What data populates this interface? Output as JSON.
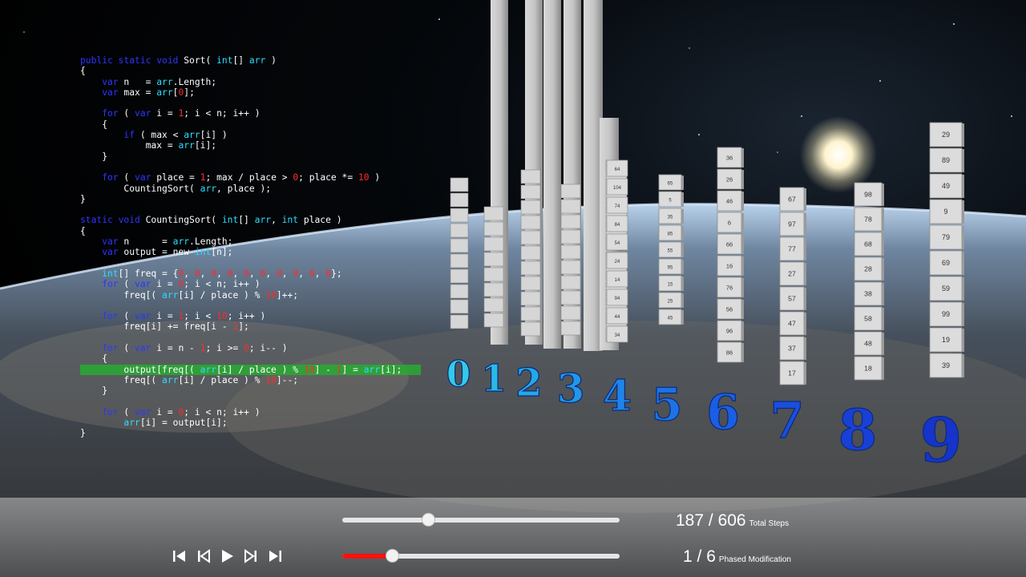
{
  "code_lines": [
    [
      [
        "kw",
        "public static void "
      ],
      [
        "t",
        "Sort( "
      ],
      [
        "ty",
        "int"
      ],
      [
        "t",
        "[] "
      ],
      [
        "ty",
        "arr"
      ],
      [
        "t",
        " )"
      ]
    ],
    [
      [
        "t",
        "{"
      ]
    ],
    [
      [
        "kw",
        "    var "
      ],
      [
        "t",
        "n   = "
      ],
      [
        "ty",
        "arr"
      ],
      [
        "t",
        ".Length;"
      ]
    ],
    [
      [
        "kw",
        "    var "
      ],
      [
        "t",
        "max = "
      ],
      [
        "ty",
        "arr"
      ],
      [
        "t",
        "["
      ],
      [
        "nu",
        "0"
      ],
      [
        "t",
        "];"
      ]
    ],
    [],
    [
      [
        "kw",
        "    for "
      ],
      [
        "t",
        "( "
      ],
      [
        "kw",
        "var "
      ],
      [
        "t",
        "i = "
      ],
      [
        "nu",
        "1"
      ],
      [
        "t",
        "; i < n; i++ )"
      ]
    ],
    [
      [
        "t",
        "    {"
      ]
    ],
    [
      [
        "kw",
        "        if "
      ],
      [
        "t",
        "( max < "
      ],
      [
        "ty",
        "arr"
      ],
      [
        "t",
        "[i] )"
      ]
    ],
    [
      [
        "t",
        "            max = "
      ],
      [
        "ty",
        "arr"
      ],
      [
        "t",
        "[i];"
      ]
    ],
    [
      [
        "t",
        "    }"
      ]
    ],
    [],
    [
      [
        "kw",
        "    for "
      ],
      [
        "t",
        "( "
      ],
      [
        "kw",
        "var "
      ],
      [
        "t",
        "place = "
      ],
      [
        "nu",
        "1"
      ],
      [
        "t",
        "; max / place > "
      ],
      [
        "nu",
        "0"
      ],
      [
        "t",
        "; place *= "
      ],
      [
        "nu",
        "10"
      ],
      [
        "t",
        " )"
      ]
    ],
    [
      [
        "t",
        "        CountingSort( "
      ],
      [
        "ty",
        "arr"
      ],
      [
        "t",
        ", place );"
      ]
    ],
    [
      [
        "t",
        "}"
      ]
    ],
    [],
    [
      [
        "kw",
        "static void "
      ],
      [
        "t",
        "CountingSort( "
      ],
      [
        "ty",
        "int"
      ],
      [
        "t",
        "[] "
      ],
      [
        "ty",
        "arr"
      ],
      [
        "t",
        ", "
      ],
      [
        "ty",
        "int "
      ],
      [
        "t",
        "place )"
      ]
    ],
    [
      [
        "t",
        "{"
      ]
    ],
    [
      [
        "kw",
        "    var "
      ],
      [
        "t",
        "n      = "
      ],
      [
        "ty",
        "arr"
      ],
      [
        "t",
        ".Length;"
      ]
    ],
    [
      [
        "kw",
        "    var "
      ],
      [
        "t",
        "output = new "
      ],
      [
        "ty",
        "int"
      ],
      [
        "t",
        "[n];"
      ]
    ],
    [],
    [
      [
        "ty",
        "    int"
      ],
      [
        "t",
        "[] freq = {"
      ],
      [
        "nu",
        "0"
      ],
      [
        "t",
        ", "
      ],
      [
        "nu",
        "0"
      ],
      [
        "t",
        ", "
      ],
      [
        "nu",
        "0"
      ],
      [
        "t",
        ", "
      ],
      [
        "nu",
        "0"
      ],
      [
        "t",
        ", "
      ],
      [
        "nu",
        "0"
      ],
      [
        "t",
        ", "
      ],
      [
        "nu",
        "0"
      ],
      [
        "t",
        ", "
      ],
      [
        "nu",
        "0"
      ],
      [
        "t",
        ", "
      ],
      [
        "nu",
        "0"
      ],
      [
        "t",
        ", "
      ],
      [
        "nu",
        "0"
      ],
      [
        "t",
        ", "
      ],
      [
        "nu",
        "0"
      ],
      [
        "t",
        "};"
      ]
    ],
    [
      [
        "kw",
        "    for "
      ],
      [
        "t",
        "( "
      ],
      [
        "kw",
        "var "
      ],
      [
        "t",
        "i = "
      ],
      [
        "nu",
        "0"
      ],
      [
        "t",
        "; i < n; i++ )"
      ]
    ],
    [
      [
        "t",
        "        freq[( "
      ],
      [
        "ty",
        "arr"
      ],
      [
        "t",
        "[i] / place ) % "
      ],
      [
        "nu",
        "10"
      ],
      [
        "t",
        "]++;"
      ]
    ],
    [],
    [
      [
        "kw",
        "    for "
      ],
      [
        "t",
        "( "
      ],
      [
        "kw",
        "var "
      ],
      [
        "t",
        "i = "
      ],
      [
        "nu",
        "1"
      ],
      [
        "t",
        "; i < "
      ],
      [
        "nu",
        "10"
      ],
      [
        "t",
        "; i++ )"
      ]
    ],
    [
      [
        "t",
        "        freq[i] += freq[i - "
      ],
      [
        "nu",
        "1"
      ],
      [
        "t",
        "];"
      ]
    ],
    [],
    [
      [
        "kw",
        "    for "
      ],
      [
        "t",
        "( "
      ],
      [
        "kw",
        "var "
      ],
      [
        "t",
        "i = n - "
      ],
      [
        "nu",
        "1"
      ],
      [
        "t",
        "; i >= "
      ],
      [
        "nu",
        "0"
      ],
      [
        "t",
        "; i-- )"
      ]
    ],
    [
      [
        "t",
        "    {"
      ]
    ],
    [
      [
        "t",
        "        output[freq[( "
      ],
      [
        "ty",
        "arr"
      ],
      [
        "t",
        "[i] / place ) % "
      ],
      [
        "nu",
        "10"
      ],
      [
        "t",
        "] - "
      ],
      [
        "nu",
        "1"
      ],
      [
        "t",
        "] = "
      ],
      [
        "ty",
        "arr"
      ],
      [
        "t",
        "[i];"
      ]
    ],
    [
      [
        "t",
        "        freq[( "
      ],
      [
        "ty",
        "arr"
      ],
      [
        "t",
        "[i] / place ) % "
      ],
      [
        "nu",
        "10"
      ],
      [
        "t",
        "]--;"
      ]
    ],
    [
      [
        "t",
        "    }"
      ]
    ],
    [],
    [
      [
        "kw",
        "    for "
      ],
      [
        "t",
        "( "
      ],
      [
        "kw",
        "var "
      ],
      [
        "t",
        "i = "
      ],
      [
        "nu",
        "0"
      ],
      [
        "t",
        "; i < n; i++ )"
      ]
    ],
    [
      [
        "t",
        "        "
      ],
      [
        "ty",
        "arr"
      ],
      [
        "t",
        "[i] = output[i];"
      ]
    ],
    [
      [
        "t",
        "}"
      ]
    ]
  ],
  "highlighted_line": 29,
  "digit_labels": [
    "0",
    "1",
    "2",
    "3",
    "4",
    "5",
    "6",
    "7",
    "8",
    "9"
  ],
  "buckets": [
    {
      "digit": "4",
      "values": [
        "64",
        "104",
        "74",
        "84",
        "54",
        "24",
        "14",
        "94",
        "44",
        "34"
      ]
    },
    {
      "digit": "5",
      "values": [
        "65",
        "5",
        "35",
        "85",
        "55",
        "95",
        "15",
        "25",
        "45"
      ]
    },
    {
      "digit": "6",
      "values": [
        "36",
        "26",
        "46",
        "6",
        "66",
        "16",
        "76",
        "56",
        "96",
        "86"
      ]
    },
    {
      "digit": "7",
      "values": [
        "67",
        "97",
        "77",
        "27",
        "57",
        "47",
        "37",
        "17"
      ]
    },
    {
      "digit": "8",
      "values": [
        "98",
        "78",
        "68",
        "28",
        "38",
        "58",
        "48",
        "18"
      ]
    },
    {
      "digit": "9",
      "values": [
        "29",
        "89",
        "49",
        "9",
        "79",
        "69",
        "59",
        "99",
        "19",
        "39"
      ]
    }
  ],
  "controls": {
    "labels": [
      "first",
      "step-back",
      "play",
      "step-forward",
      "last"
    ],
    "steps": {
      "current": "187",
      "separator": "/",
      "total": "606",
      "label": "Total Steps",
      "fraction": 0.31
    },
    "phases": {
      "current": "1",
      "separator": "/",
      "total": "6",
      "label": "Phased Modification",
      "fraction": 0.18
    }
  },
  "colors": {
    "keyword": "#2f36ff",
    "type": "#2fdcff",
    "number": "#ff2a2a",
    "highlight": "#2aaa32",
    "progress": "#ff1010"
  }
}
